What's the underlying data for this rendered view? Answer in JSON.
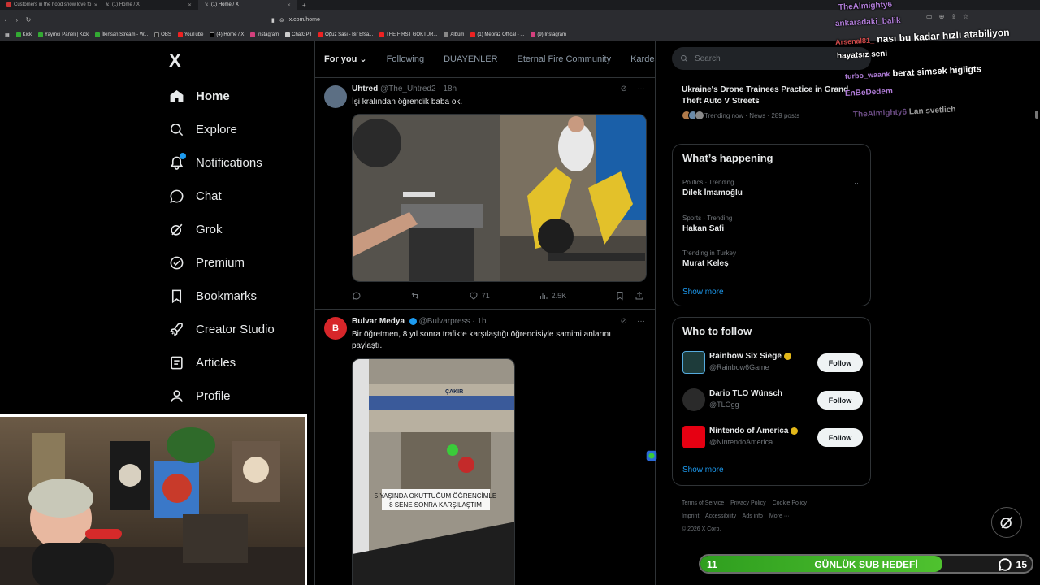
{
  "browser": {
    "tabs": [
      {
        "label": "Customers in the hood show love fo",
        "active": false
      },
      {
        "label": "(1) Home / X",
        "active": false
      },
      {
        "label": "(1) Home / X",
        "active": true
      }
    ],
    "url": "x.com/home",
    "bookmarks": [
      "Kick",
      "Yayıncı Paneli | Kick",
      "İlkinsan Stream - W...",
      "OBS",
      "YouTube",
      "(4) Home / X",
      "Instagram",
      "ChatGPT",
      "Oğuz Sasi - Bir Efsa...",
      "THE FIRST GOKTUR...",
      "Albüm",
      "(1) Mepraz Offical - ...",
      "(9) Instagram"
    ]
  },
  "nav": {
    "logo": "X",
    "items": [
      {
        "label": "Home",
        "icon": "home-icon"
      },
      {
        "label": "Explore",
        "icon": "search-icon"
      },
      {
        "label": "Notifications",
        "icon": "bell-icon"
      },
      {
        "label": "Chat",
        "icon": "chat-icon"
      },
      {
        "label": "Grok",
        "icon": "grok-icon"
      },
      {
        "label": "Premium",
        "icon": "premium-icon"
      },
      {
        "label": "Bookmarks",
        "icon": "bookmark-icon"
      },
      {
        "label": "Creator Studio",
        "icon": "rocket-icon"
      },
      {
        "label": "Articles",
        "icon": "articles-icon"
      },
      {
        "label": "Profile",
        "icon": "person-icon"
      }
    ]
  },
  "timeline": {
    "tabs": [
      "For you",
      "Following",
      "DUAYENLER",
      "Eternal Fire Community",
      "Kardeşle"
    ],
    "tweets": [
      {
        "name": "Uhtred",
        "handle": "@The_Uhtred2 · 18h",
        "text": "İşi kralından öğrendik baba ok.",
        "likes": "71",
        "views": "2.5K"
      },
      {
        "name": "Bulvar Medya",
        "handle": "@Bulvarpress · 1h",
        "text": "Bir öğretmen, 8 yıl sonra trafikte karşılaştığı öğrencisiyle samimi anlarını paylaştı.",
        "caption_line1": "5 YAŞINDA OKUTTUĞUM ÖĞRENCİMLE",
        "caption_line2": "8 SENE SONRA KARŞILAŞTIM",
        "sign": "ÇAKIR"
      }
    ]
  },
  "sidebar": {
    "search_placeholder": "Search",
    "news": {
      "title": "Ukraine's Drone Trainees Practice in Grand Theft Auto V Streets",
      "meta": "Trending now · News · 289 posts"
    },
    "whats_happening": {
      "title": "What’s happening",
      "trends": [
        {
          "meta": "Politics · Trending",
          "name": "Dilek İmamoğlu"
        },
        {
          "meta": "Sports · Trending",
          "name": "Hakan Safi"
        },
        {
          "meta": "Trending in Turkey",
          "name": "Murat Keleş"
        }
      ],
      "show_more": "Show more"
    },
    "who_to_follow": {
      "title": "Who to follow",
      "accounts": [
        {
          "name": "Rainbow Six Siege",
          "handle": "@Rainbow6Game",
          "button": "Follow"
        },
        {
          "name": "Dario TLO Wünsch",
          "handle": "@TLOgg",
          "button": "Follow"
        },
        {
          "name": "Nintendo of America",
          "handle": "@NintendoAmerica",
          "button": "Follow"
        }
      ],
      "show_more": "Show more"
    },
    "footer": [
      "Terms of Service",
      "Privacy Policy",
      "Cookie Policy",
      "Imprint",
      "Accessibility",
      "Ads info",
      "More ···",
      "© 2026 X Corp."
    ]
  },
  "stream_chat": [
    {
      "user": "TheAlmighty6",
      "message": ""
    },
    {
      "user": "ankaradaki_balik",
      "message": ""
    },
    {
      "user": "Arsenal81_",
      "message": "nası bu kadar hızlı atabiliyon"
    },
    {
      "user": "",
      "message": "hayatsız seni"
    },
    {
      "user": "turbo_waank",
      "message": "berat simsek higligts"
    },
    {
      "user": "EnBeDedem",
      "message": ""
    },
    {
      "user": "TheAlmighty6",
      "message": "Lan svetlich"
    }
  ],
  "sub_goal": {
    "current": "11",
    "label": "GÜNLÜK SUB HEDEFİ",
    "goal": "15",
    "progress": 0.73
  }
}
